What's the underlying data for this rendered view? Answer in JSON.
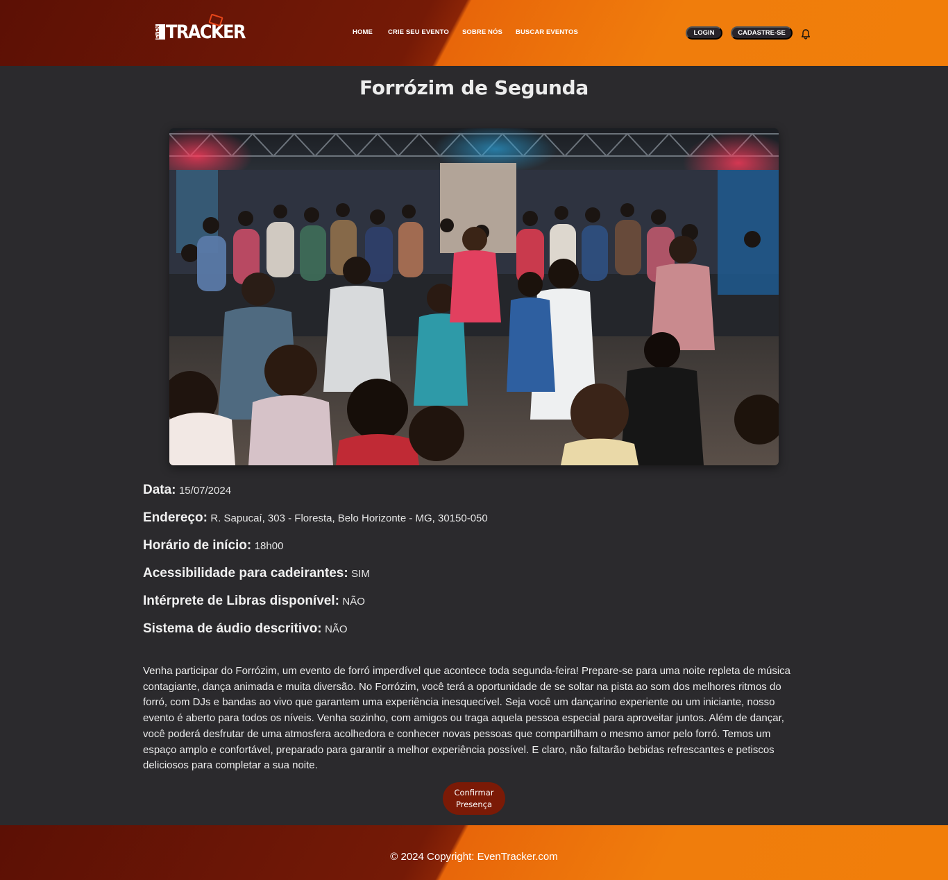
{
  "brand": {
    "logo_small": "EVEN",
    "logo_text": "TRACKER"
  },
  "nav": {
    "items": [
      "HOME",
      "CRIE SEU EVENTO",
      "SOBRE NÓS",
      "BUSCAR EVENTOS"
    ],
    "login": "LOGIN",
    "signup": "CADASTRE-SE",
    "notifications_icon": "bell-icon"
  },
  "event": {
    "title": "Forrózim de Segunda",
    "image_alt": "event-photo",
    "details": [
      {
        "label": "Data:",
        "value": "15/07/2024"
      },
      {
        "label": "Endereço:",
        "value": "R. Sapucaí, 303 - Floresta, Belo Horizonte - MG, 30150-050"
      },
      {
        "label": "Horário de início:",
        "value": "18h00"
      },
      {
        "label": "Acessibilidade para cadeirantes:",
        "value": "SIM"
      },
      {
        "label": "Intérprete de Libras disponível:",
        "value": "NÃO"
      },
      {
        "label": "Sistema de áudio descritivo:",
        "value": "NÃO"
      }
    ],
    "description": "Venha participar do Forrózim, um evento de forró imperdível que acontece toda segunda-feira! Prepare-se para uma noite repleta de música contagiante, dança animada e muita diversão. No Forrózim, você terá a oportunidade de se soltar na pista ao som dos melhores ritmos do forró, com DJs e bandas ao vivo que garantem uma experiência inesquecível. Seja você um dançarino experiente ou um iniciante, nosso evento é aberto para todos os níveis. Venha sozinho, com amigos ou traga aquela pessoa especial para aproveitar juntos. Além de dançar, você poderá desfrutar de uma atmosfera acolhedora e conhecer novas pessoas que compartilham o mesmo amor pelo forró. Temos um espaço amplo e confortável, preparado para garantir a melhor experiência possível. E claro, não faltarão bebidas refrescantes e petiscos deliciosos para completar a sua noite.",
    "confirm_button": "Confirmar Presença"
  },
  "footer": {
    "copyright": "© 2024 Copyright: EvenTracker.com"
  },
  "colors": {
    "header_dark": "#751a06",
    "header_orange": "#f07d0c",
    "background": "#2b2a2d",
    "pill": "#28242a",
    "confirm_button": "#7b1a06"
  }
}
